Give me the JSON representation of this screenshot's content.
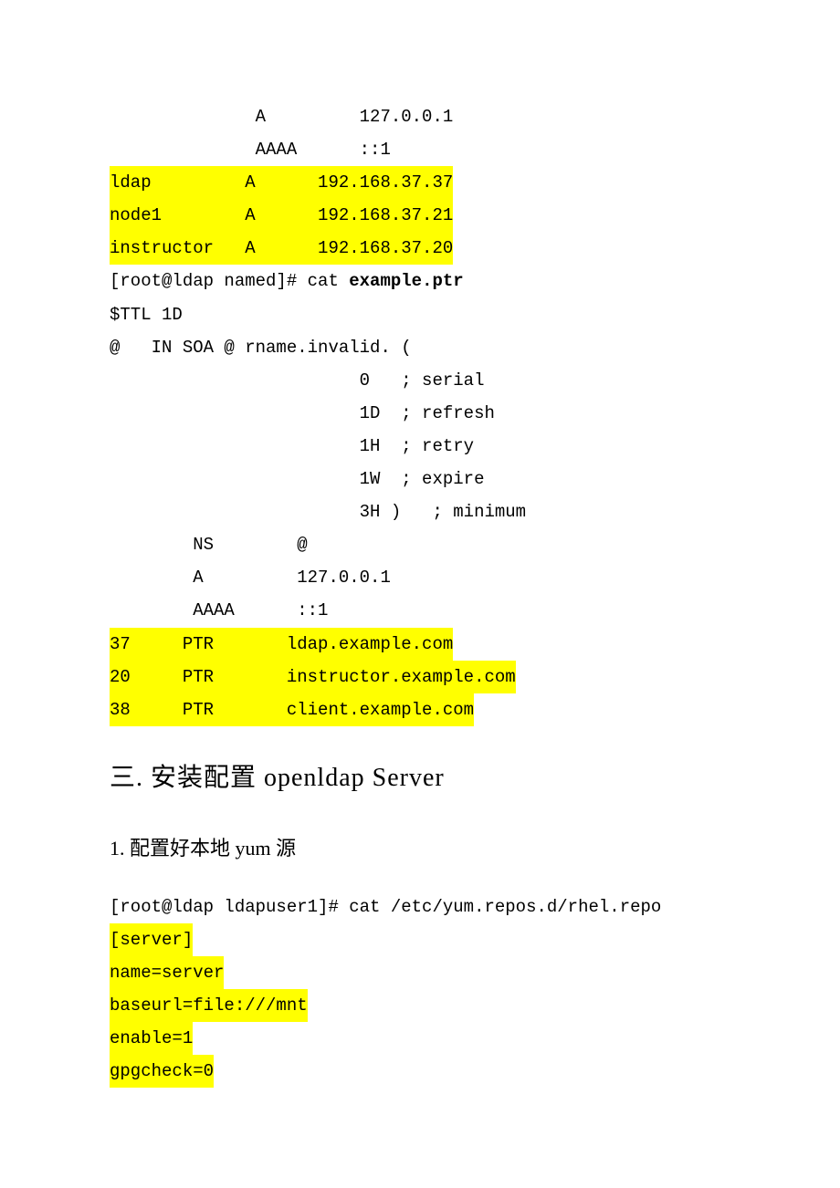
{
  "records_a": [
    {
      "name": "",
      "type": "A",
      "value": "127.0.0.1",
      "hl": false
    },
    {
      "name": "",
      "type": "AAAA",
      "value": "::1",
      "hl": false
    },
    {
      "name": "ldap",
      "type": "A",
      "value": "192.168.37.37",
      "hl": true
    },
    {
      "name": "node1",
      "type": "A",
      "value": "192.168.37.21",
      "hl": true
    },
    {
      "name": "instructor",
      "type": "A",
      "value": "192.168.37.20",
      "hl": true
    }
  ],
  "cat_ptr_cmd_prefix": "[root@ldap named]# cat ",
  "cat_ptr_file": "example.ptr",
  "ttl_line": "$TTL 1D",
  "soa_line": "@   IN SOA @ rname.invalid. (",
  "soa_params": [
    "                        0   ; serial",
    "                        1D  ; refresh",
    "                        1H  ; retry",
    "                        1W  ; expire",
    "                        3H )   ; minimum"
  ],
  "ns_line": "        NS        @",
  "a_line": "        A         127.0.0.1",
  "aaaa_line": "        AAAA      ::1",
  "ptr_records": [
    {
      "id": "37",
      "type": "PTR",
      "value": "ldap.example.com"
    },
    {
      "id": "20",
      "type": "PTR",
      "value": "instructor.example.com"
    },
    {
      "id": "38",
      "type": "PTR",
      "value": "client.example.com"
    }
  ],
  "heading_section": "三. 安装配置 openldap Server",
  "heading_sub": "1. 配置好本地 yum 源",
  "yum_cmd": "[root@ldap ldapuser1]# cat /etc/yum.repos.d/rhel.repo",
  "repo_lines": [
    "[server]",
    "name=server",
    "baseurl=file:///mnt",
    "enable=1",
    "gpgcheck=0"
  ]
}
